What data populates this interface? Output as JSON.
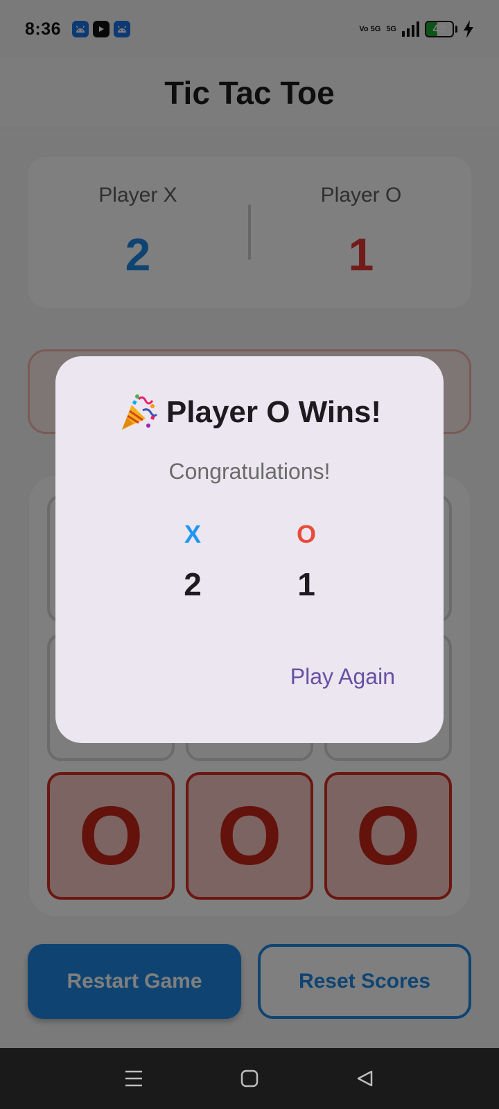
{
  "status_bar": {
    "time": "8:36",
    "network_volte": "Vo 5G",
    "network_type": "5G",
    "battery": "42",
    "battery_level": 0.42,
    "colors": {
      "battery_fill": "#1fa631"
    },
    "notification_icons": [
      "android-icon",
      "youtube-icon",
      "android-icon"
    ]
  },
  "app_bar": {
    "title": "Tic Tac Toe"
  },
  "scoreboard": {
    "player_x_label": "Player X",
    "player_x_score": "2",
    "player_o_label": "Player O",
    "player_o_score": "1",
    "colors": {
      "x": "#1e88e5",
      "o": "#e53935"
    }
  },
  "board": {
    "cells": [
      "",
      "",
      "",
      "",
      "",
      "",
      "O",
      "O",
      "O"
    ],
    "winning_row": [
      6,
      7,
      8
    ]
  },
  "buttons": {
    "restart": "Restart Game",
    "reset": "Reset Scores"
  },
  "dialog": {
    "title": "Player O Wins!",
    "title_icon": "party-popper-icon",
    "subtitle": "Congratulations!",
    "x_symbol": "X",
    "x_score": "2",
    "o_symbol": "O",
    "o_score": "1",
    "action": "Play Again",
    "colors": {
      "background": "#ece6f0",
      "action": "#6750a4",
      "x": "#2196f3",
      "o": "#e74c3c"
    }
  },
  "nav_bar": {
    "icons": [
      "menu-icon",
      "home-icon",
      "back-icon"
    ]
  }
}
